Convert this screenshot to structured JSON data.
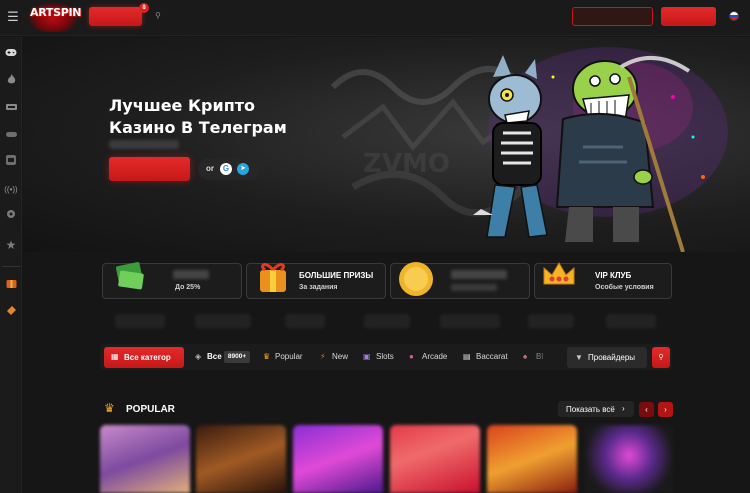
{
  "brand": {
    "logo_text": "ARTSPIN",
    "accent": "#e31d1d"
  },
  "header": {
    "promo_badge": "8",
    "icons": [
      "menu-icon",
      "search-icon",
      "flag-ru-icon"
    ]
  },
  "sidebar": {
    "icons": [
      "gamepad-icon",
      "fire-icon",
      "live-icon",
      "table-icon",
      "slot-icon",
      "broadcast-icon",
      "settings-icon",
      "star-icon",
      "promo-icon",
      "ticket-icon"
    ]
  },
  "hero": {
    "title_line1": "Лучшее Крипто",
    "title_line2": "Казино В Телеграм",
    "or_label": "or",
    "google_glyph": "G",
    "telegram_glyph": "➤"
  },
  "cards": [
    {
      "title": "",
      "subtitle": "До 25%"
    },
    {
      "title": "БОЛЬШИЕ ПРИЗЫ",
      "subtitle": "За задания"
    },
    {
      "title": "",
      "subtitle": ""
    },
    {
      "title": "VIP КЛУБ",
      "subtitle": "Особые условия"
    }
  ],
  "categories": {
    "active_label": "Все категор",
    "items": [
      {
        "label": "Все",
        "count": "8900+"
      },
      {
        "label": "Popular"
      },
      {
        "label": "New"
      },
      {
        "label": "Slots"
      },
      {
        "label": "Arcade"
      },
      {
        "label": "Baccarat"
      },
      {
        "label": "Bl"
      }
    ],
    "providers_label": "Провайдеры"
  },
  "popular": {
    "title": "POPULAR",
    "show_all_label": "Показать всё",
    "prev_glyph": "‹",
    "next_glyph": "›"
  }
}
